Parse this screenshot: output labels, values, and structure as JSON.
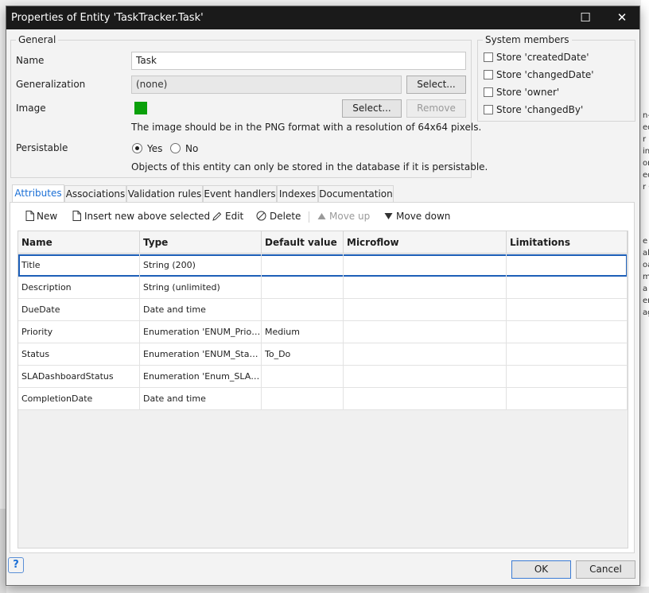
{
  "background": {
    "fragments": [
      "n-p",
      "ed",
      "r us",
      "ink",
      "on",
      "ed",
      "r C",
      "",
      "",
      "",
      "",
      "",
      "",
      "",
      "",
      "e",
      "alo",
      "oa",
      "mb",
      "a u",
      "er",
      "ag"
    ]
  },
  "dialog": {
    "title": "Properties of Entity 'TaskTracker.Task'",
    "maximize_glyph": "☐",
    "close_glyph": "✕"
  },
  "general": {
    "group_title": "General",
    "name_label": "Name",
    "name_value": "Task",
    "generalization_label": "Generalization",
    "generalization_value": "(none)",
    "generalization_select": "Select...",
    "image_label": "Image",
    "image_color": "#0aa00a",
    "image_select": "Select...",
    "image_remove": "Remove",
    "image_hint": "The image should be in the PNG format with a resolution of 64x64 pixels.",
    "persistable_label": "Persistable",
    "yes_label": "Yes",
    "no_label": "No",
    "persistable_value": "Yes",
    "persistable_hint": "Objects of this entity can only be stored in the database if it is persistable."
  },
  "system_members": {
    "group_title": "System members",
    "items": [
      {
        "label": "Store 'createdDate'",
        "checked": false
      },
      {
        "label": "Store 'changedDate'",
        "checked": false
      },
      {
        "label": "Store 'owner'",
        "checked": false
      },
      {
        "label": "Store 'changedBy'",
        "checked": false
      }
    ]
  },
  "tabs": [
    {
      "label": "Attributes",
      "active": true
    },
    {
      "label": "Associations",
      "active": false
    },
    {
      "label": "Validation rules",
      "active": false
    },
    {
      "label": "Event handlers",
      "active": false
    },
    {
      "label": "Indexes",
      "active": false
    },
    {
      "label": "Documentation",
      "active": false
    }
  ],
  "toolbar": {
    "new_label": "New",
    "insert_label": "Insert new above selected",
    "edit_label": "Edit",
    "delete_label": "Delete",
    "move_up_label": "Move up",
    "move_down_label": "Move down"
  },
  "grid": {
    "columns": [
      "Name",
      "Type",
      "Default value",
      "Microflow",
      "Limitations"
    ],
    "rows": [
      {
        "name": "Title",
        "type": "String (200)",
        "default": "",
        "microflow": "",
        "limitations": "",
        "selected": true
      },
      {
        "name": "Description",
        "type": "String (unlimited)",
        "default": "",
        "microflow": "",
        "limitations": ""
      },
      {
        "name": "DueDate",
        "type": "Date and time",
        "default": "",
        "microflow": "",
        "limitations": ""
      },
      {
        "name": "Priority",
        "type": "Enumeration 'ENUM_Priority'",
        "default": "Medium",
        "microflow": "",
        "limitations": ""
      },
      {
        "name": "Status",
        "type": "Enumeration 'ENUM_Status'",
        "default": "To_Do",
        "microflow": "",
        "limitations": ""
      },
      {
        "name": "SLADashboardStatus",
        "type": "Enumeration 'Enum_SLADa...",
        "default": "",
        "microflow": "",
        "limitations": ""
      },
      {
        "name": "CompletionDate",
        "type": "Date and time",
        "default": "",
        "microflow": "",
        "limitations": ""
      }
    ]
  },
  "footer": {
    "help_glyph": "?",
    "ok_label": "OK",
    "cancel_label": "Cancel"
  }
}
